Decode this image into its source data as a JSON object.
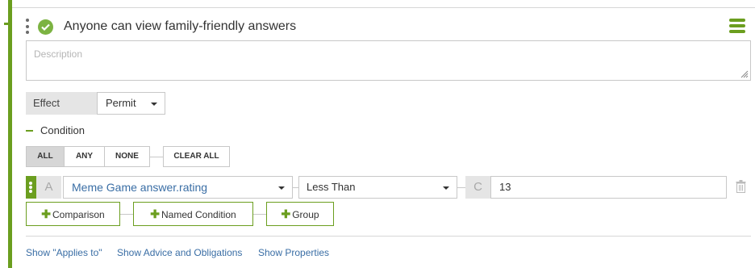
{
  "rule": {
    "title": "Anyone can view family-friendly answers",
    "description_placeholder": "Description",
    "accent_color": "#6b9e1f",
    "status_icon": "check-circle-icon",
    "menu_icon": "hamburger-menu-icon"
  },
  "effect": {
    "label": "Effect",
    "selected": "Permit"
  },
  "condition": {
    "label": "Condition",
    "modes": [
      "ALL",
      "ANY",
      "NONE"
    ],
    "active_mode": "ALL",
    "clear_all": "CLEAR ALL",
    "row": {
      "left_letter": "A",
      "attribute": "Meme Game answer.rating",
      "operator": "Less Than",
      "right_letter": "C",
      "value": "13"
    },
    "buttons": {
      "comparison": "Comparison",
      "named_condition": "Named Condition",
      "group": "Group"
    }
  },
  "footer_links": {
    "applies_to": "Show \"Applies to\"",
    "advice": "Show Advice and Obligations",
    "properties": "Show Properties"
  }
}
